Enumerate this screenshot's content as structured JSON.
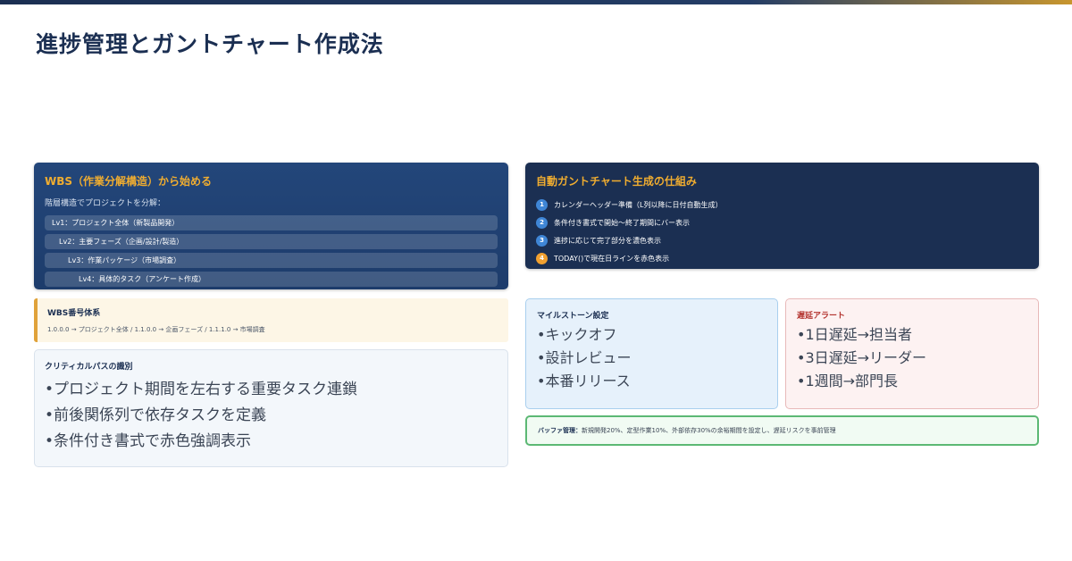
{
  "page": {
    "title": "進捗管理とガントチャート作成法"
  },
  "wbs": {
    "heading": "WBS（作業分解構造）から始める",
    "intro": "階層構造でプロジェクトを分解：",
    "levels": [
      "Lv1：プロジェクト全体（新製品開発）",
      "Lv2：主要フェーズ（企画/設計/製造）",
      "Lv3：作業パッケージ（市場調査）",
      "Lv4：具体的タスク（アンケート作成）"
    ]
  },
  "gantt": {
    "heading": "自動ガントチャート生成の仕組み",
    "steps": [
      {
        "num": "1",
        "text": "カレンダーヘッダー準備（L列以降に日付自動生成）"
      },
      {
        "num": "2",
        "text": "条件付き書式で開始〜終了期間にバー表示"
      },
      {
        "num": "3",
        "text": "進捗に応じて完了部分を濃色表示"
      },
      {
        "num": "4",
        "text": "TODAY()で現在日ラインを赤色表示"
      }
    ]
  },
  "wbs_numbering": {
    "heading": "WBS番号体系",
    "line": "1.0.0.0 → プロジェクト全体 / 1.1.0.0 → 企画フェーズ / 1.1.1.0 → 市場調査"
  },
  "critical_path": {
    "heading": "クリティカルパスの識別",
    "items": [
      "•プロジェクト期間を左右する重要タスク連鎖",
      "•前後関係列で依存タスクを定義",
      "•条件付き書式で赤色強調表示"
    ]
  },
  "milestone": {
    "heading": "マイルストーン設定",
    "items": [
      "•キックオフ",
      "•設計レビュー",
      "•本番リリース"
    ]
  },
  "delay_alert": {
    "heading": "遅延アラート",
    "items": [
      "•1日遅延→担当者",
      "•3日遅延→リーダー",
      "•1週間→部門長"
    ]
  },
  "buffer": {
    "label": "バッファ管理：",
    "text": "新規開発20%、定型作業10%、外部依存30%の余裕期間を設定し、遅延リスクを事前管理"
  },
  "colors": {
    "navy": "#1b2f52",
    "gold": "#f0ad30",
    "step_blue": "#3f86d6",
    "alert_red": "#b3322d",
    "buffer_green": "#5cb874"
  }
}
